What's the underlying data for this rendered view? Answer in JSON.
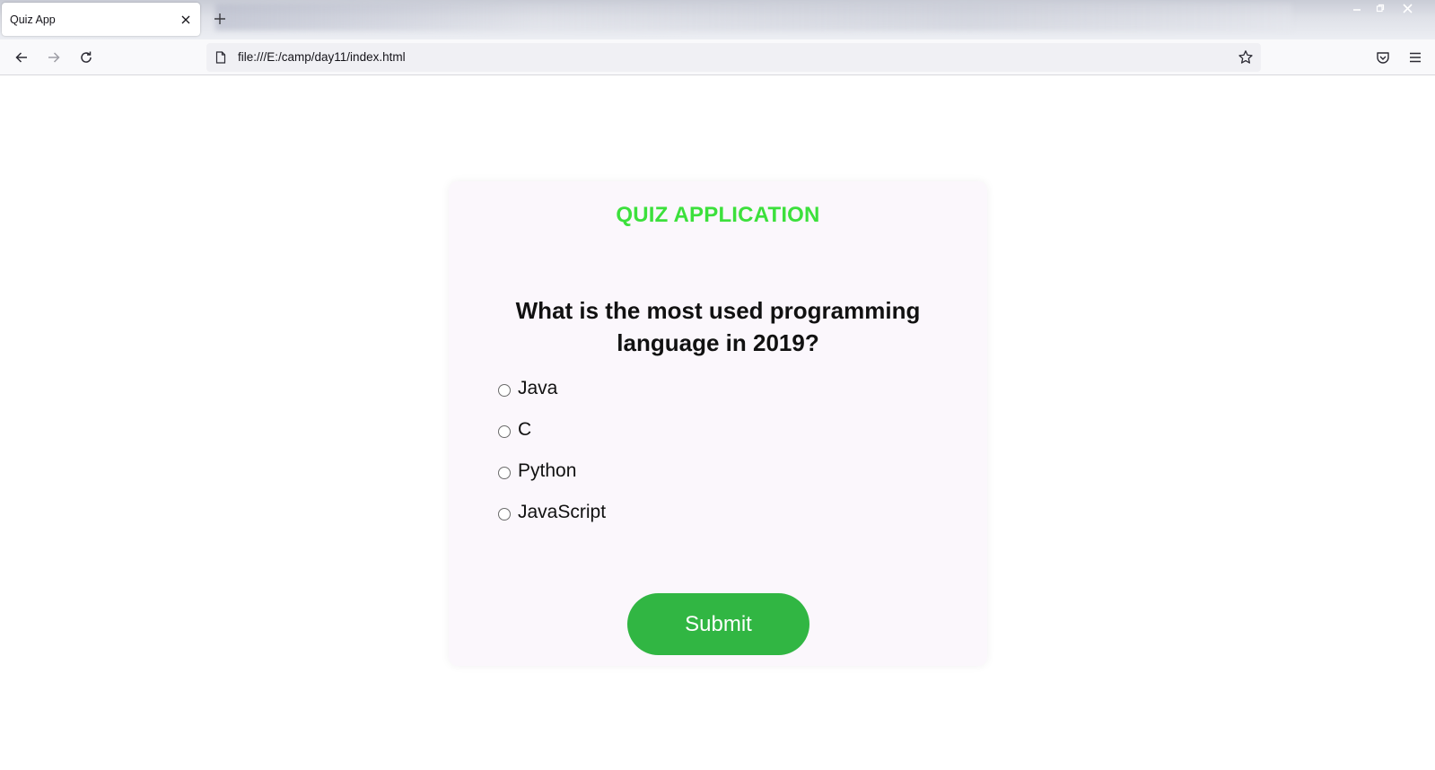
{
  "browser": {
    "tab": {
      "title": "Quiz App"
    },
    "url": "file:///E:/camp/day11/index.html"
  },
  "icons": {
    "tab_close": "close-icon",
    "new_tab": "plus-icon",
    "back": "arrow-left-icon",
    "forward": "arrow-right-icon",
    "reload": "reload-icon",
    "page": "page-icon",
    "bookmark": "star-icon",
    "pocket": "pocket-icon",
    "menu": "hamburger-menu-icon",
    "minimize": "minimize-icon",
    "restore": "restore-icon",
    "close_window": "close-icon"
  },
  "quiz": {
    "title": "QUIZ APPLICATION",
    "question": "What is the most used programming language in 2019?",
    "options": [
      {
        "label": "Java",
        "selected": false
      },
      {
        "label": "C",
        "selected": false
      },
      {
        "label": "Python",
        "selected": false
      },
      {
        "label": "JavaScript",
        "selected": false
      }
    ],
    "submit_label": "Submit"
  },
  "colors": {
    "title": "#3ce03c",
    "submit_bg": "#31b643",
    "card_bg": "#fbf7fc"
  }
}
